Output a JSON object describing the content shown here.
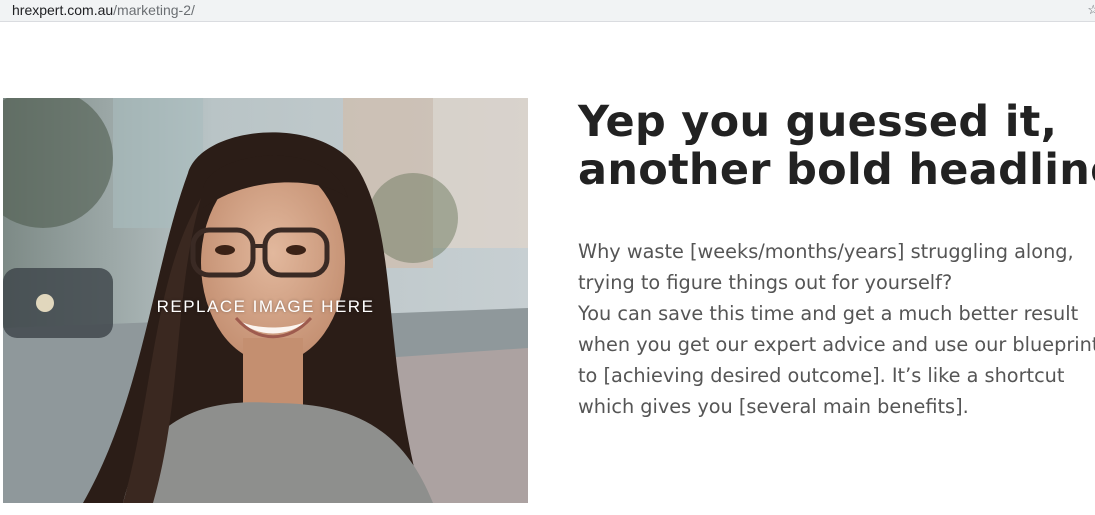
{
  "browser": {
    "url_domain": "hrexpert.com.au",
    "url_path": "/marketing-2/",
    "star_icon": "star-icon"
  },
  "hero": {
    "image_label": "REPLACE IMAGE HERE",
    "image_subject": "smiling-woman-with-glasses-photo"
  },
  "content": {
    "headline_lines": [
      "Yep you guessed it,",
      "another bold headline"
    ],
    "body_lines": [
      "Why waste [weeks/months/years] struggling along,",
      "trying to figure things out for yourself?",
      "You can save this time and get a much better result",
      "when you get our expert advice and use our blueprint",
      "to [achieving desired outcome]. It’s like a shortcut",
      "which gives you [several main benefits]."
    ]
  },
  "colors": {
    "headline": "#222222",
    "body": "#555555",
    "urlbar_bg": "#f1f3f4"
  }
}
